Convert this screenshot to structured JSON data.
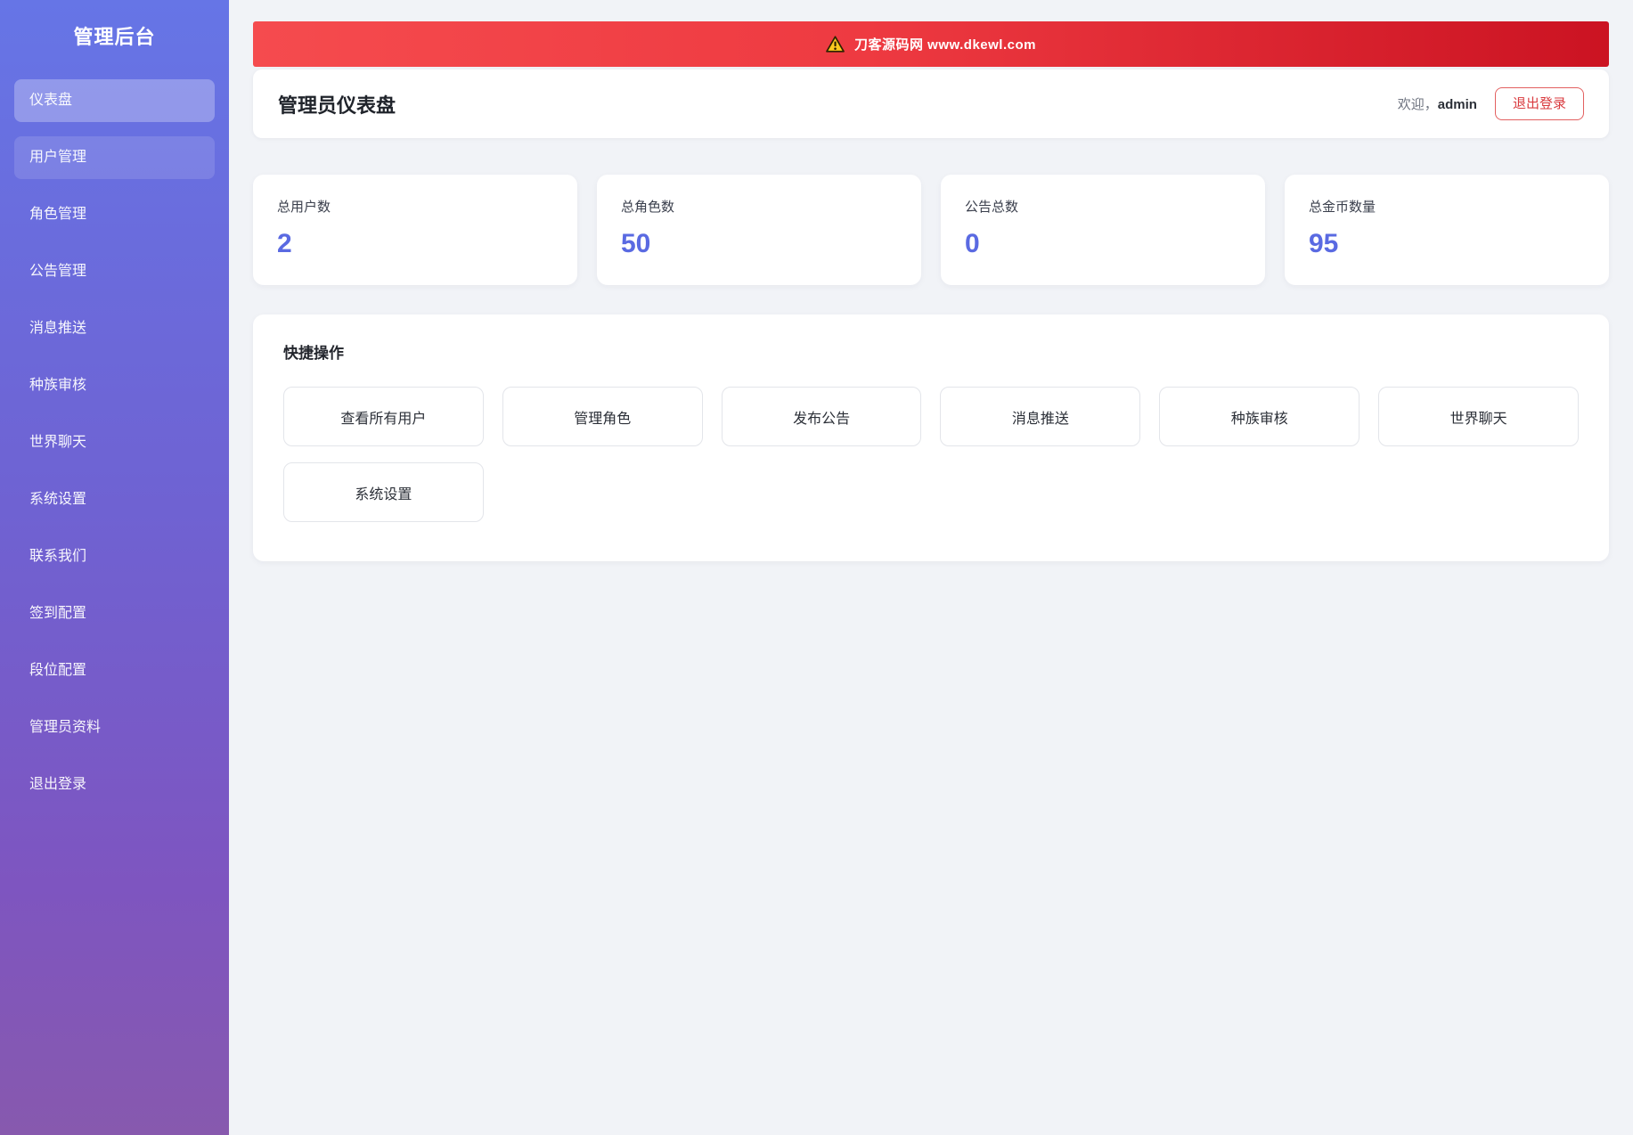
{
  "sidebar": {
    "title": "管理后台",
    "items": [
      {
        "label": "仪表盘",
        "state": "active"
      },
      {
        "label": "用户管理",
        "state": "hover"
      },
      {
        "label": "角色管理",
        "state": ""
      },
      {
        "label": "公告管理",
        "state": ""
      },
      {
        "label": "消息推送",
        "state": ""
      },
      {
        "label": "种族审核",
        "state": ""
      },
      {
        "label": "世界聊天",
        "state": ""
      },
      {
        "label": "系统设置",
        "state": ""
      },
      {
        "label": "联系我们",
        "state": ""
      },
      {
        "label": "签到配置",
        "state": ""
      },
      {
        "label": "段位配置",
        "state": ""
      },
      {
        "label": "管理员资料",
        "state": ""
      },
      {
        "label": "退出登录",
        "state": ""
      }
    ]
  },
  "banner": {
    "icon": "warning-icon",
    "text": "刀客源码网 www.dkewl.com"
  },
  "header": {
    "title": "管理员仪表盘",
    "welcome_prefix": "欢迎，",
    "username": "admin",
    "logout_label": "退出登录"
  },
  "stats": [
    {
      "label": "总用户数",
      "value": "2"
    },
    {
      "label": "总角色数",
      "value": "50"
    },
    {
      "label": "公告总数",
      "value": "0"
    },
    {
      "label": "总金币数量",
      "value": "95"
    }
  ],
  "quick_actions": {
    "title": "快捷操作",
    "buttons": [
      "查看所有用户",
      "管理角色",
      "发布公告",
      "消息推送",
      "种族审核",
      "世界聊天",
      "系统设置"
    ]
  },
  "colors": {
    "sidebar_gradient_top": "#6675e6",
    "sidebar_gradient_bottom": "#8759ae",
    "banner_red_left": "#f54b4e",
    "banner_red_right": "#cb1322",
    "accent_indigo": "#5a6ae2",
    "danger_red": "#d93b3f",
    "page_background": "#f1f3f7"
  }
}
